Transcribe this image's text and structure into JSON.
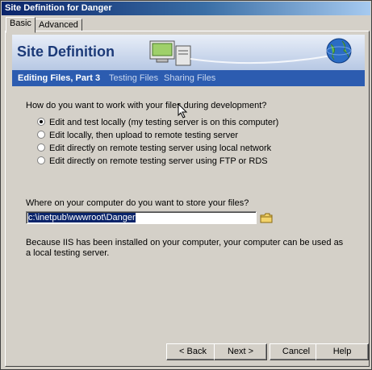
{
  "window": {
    "title": "Site Definition for Danger"
  },
  "tabs": [
    {
      "label": "Basic"
    },
    {
      "label": "Advanced"
    }
  ],
  "banner": {
    "title": "Site Definition"
  },
  "steps": [
    {
      "label": "Editing Files, Part 3"
    },
    {
      "label": "Testing Files"
    },
    {
      "label": "Sharing Files"
    }
  ],
  "question": "How do you want to work with your files during development?",
  "options": [
    {
      "label": "Edit and test locally (my testing server is on this computer)",
      "checked": true
    },
    {
      "label": "Edit locally, then upload to remote testing server",
      "checked": false
    },
    {
      "label": "Edit directly on remote testing server using local network",
      "checked": false
    },
    {
      "label": "Edit directly on remote testing server using FTP or RDS",
      "checked": false
    }
  ],
  "location": {
    "label": "Where on your computer do you want to store your files?",
    "value": "c:\\inetpub\\wwwroot\\Danger"
  },
  "note": "Because IIS has been installed on your computer, your computer can be used as a local testing server.",
  "buttons": {
    "back": "< Back",
    "next": "Next >",
    "cancel": "Cancel",
    "help": "Help"
  },
  "icons": {
    "folder": "folder-icon",
    "globe": "globe-icon",
    "computer": "computer-icon",
    "cursor": "mouse-cursor-icon"
  },
  "colors": {
    "stepbar": "#2c5cb0",
    "title_text": "#1c3a78",
    "titlebar": "#0a246a"
  }
}
